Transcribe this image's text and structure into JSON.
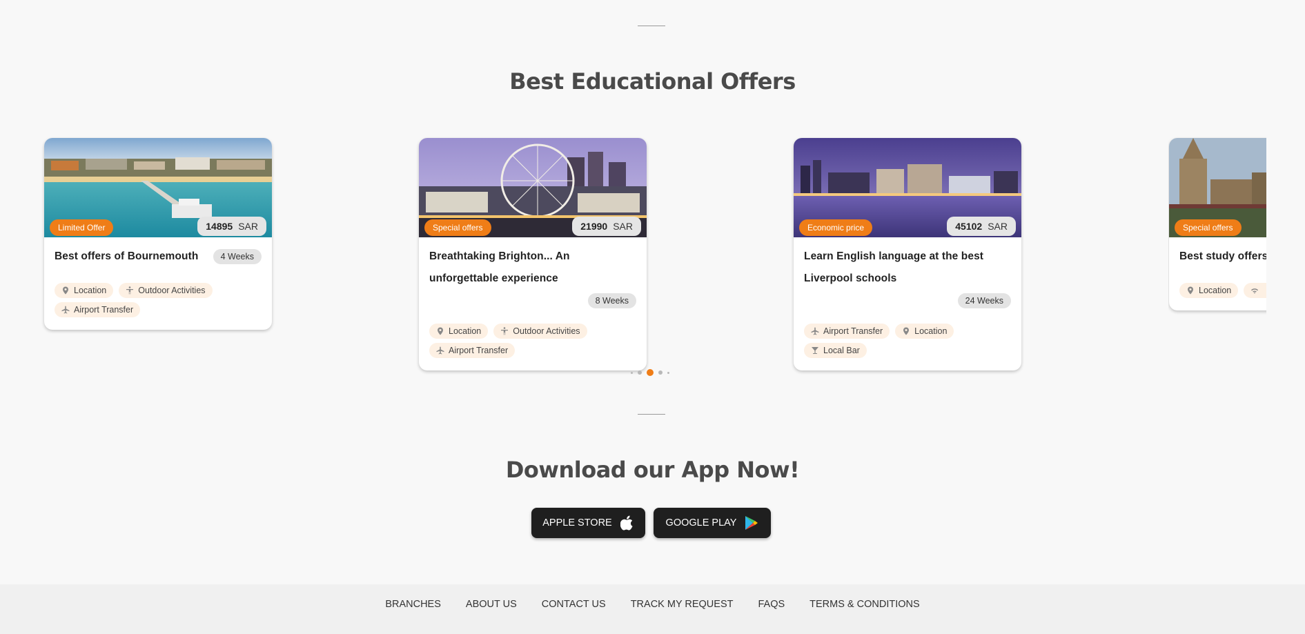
{
  "offers_section": {
    "title": "Best Educational Offers"
  },
  "cards": [
    {
      "badge": "Limited Offer",
      "price": "14895",
      "currency": "SAR",
      "title": "Best offers of Bournemouth",
      "duration": "4 Weeks",
      "tags": [
        "Location",
        "Outdoor Activities",
        "Airport Transfer"
      ]
    },
    {
      "badge": "Special offers",
      "price": "21990",
      "currency": "SAR",
      "title": "Breathtaking Brighton... An unforgettable experience",
      "duration": "8 Weeks",
      "tags": [
        "Location",
        "Outdoor Activities",
        "Airport Transfer"
      ]
    },
    {
      "badge": "Economic price",
      "price": "45102",
      "currency": "SAR",
      "title": "Learn English language at the best Liverpool schools",
      "duration": "24 Weeks",
      "tags": [
        "Airport Transfer",
        "Location",
        "Local Bar"
      ]
    },
    {
      "badge": "Special offers",
      "title": "Best study offers",
      "tags": [
        "Location"
      ]
    }
  ],
  "carousel": {
    "dot_count": 5,
    "active_dot": 3
  },
  "app_section": {
    "title": "Download our App Now!",
    "apple_label": "APPLE STORE",
    "google_label": "GOOGLE PLAY"
  },
  "footer": {
    "links": [
      "BRANCHES",
      "ABOUT US",
      "CONTACT US",
      "TRACK MY REQUEST",
      "FAQS",
      "TERMS & CONDITIONS"
    ]
  },
  "colors": {
    "accent": "#ef7d17",
    "tag_bg": "#fdf0e3",
    "button_bg": "#1f1f1f"
  },
  "icons": {
    "Location": "location-pin-icon",
    "Outdoor Activities": "person-activity-icon",
    "Airport Transfer": "airplane-icon",
    "Local Bar": "cocktail-glass-icon",
    "Wifi": "wifi-icon"
  }
}
